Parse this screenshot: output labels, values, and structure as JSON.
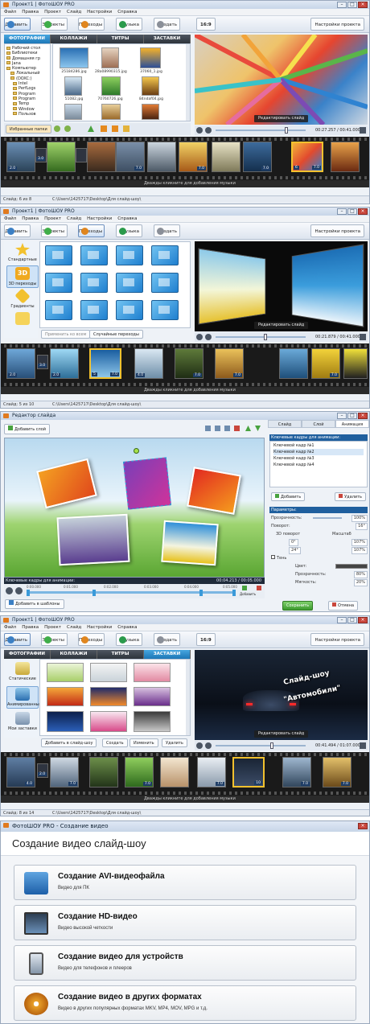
{
  "s1": {
    "title": "Проект1 | ФотоШОУ PRO",
    "menu": [
      "Файл",
      "Правка",
      "Проект",
      "Слайд",
      "Настройки",
      "Справка"
    ],
    "tools": [
      "Добавить",
      "Эффекты",
      "Переходы",
      "Музыка",
      "Создать"
    ],
    "aspect": "16:9",
    "project_settings": "Настройки проекта",
    "tabs": [
      "ФОТОГРАФИИ",
      "КОЛЛАЖИ",
      "ТИТРЫ",
      "ЗАСТАВКИ"
    ],
    "folders": [
      "Рабочий стол",
      "Библиотеки",
      "Домашняя гр",
      "Jana",
      "Компьютер",
      "Локальный",
      "(DOXC:)",
      "Intel",
      "PerfLogs",
      "Program",
      "Program",
      "Temp",
      "Window",
      "Пользов"
    ],
    "files": [
      "25184286.jpg",
      "28a08990315.jpg",
      "37060_1.jpg",
      "",
      "",
      "",
      "51082.jpg",
      "70760726.jpg",
      "84ndaf04.jpg",
      "",
      "",
      ""
    ],
    "fav": "Избранные папки",
    "edit": "Редактировать слайд",
    "time": "00:27.257 / 00:41.000",
    "frames": [
      "2.0",
      "3.0",
      "",
      "",
      "7.0",
      "",
      "7.0",
      "",
      "",
      "7.0",
      "",
      "7.0",
      "6",
      "7.0",
      "3"
    ],
    "music": "Дважды кликните для добавления музыки",
    "status": "Слайд: 6 из 8",
    "path": "C:\\Users\\1425717\\Desktop\\Для слайд-шоу\\"
  },
  "s2": {
    "title": "Проект1 | ФотоШОУ PRO",
    "menu": [
      "Файл",
      "Правка",
      "Проект",
      "Слайд",
      "Настройки",
      "Справка"
    ],
    "tools": [
      "Добавить",
      "Эффекты",
      "Переходы",
      "Музыка",
      "Создать"
    ],
    "project_settings": "Настройки проекта",
    "side": [
      "Стандартные",
      "3D переходы",
      "Градиенты",
      ""
    ],
    "apply_all": "Применить ко всем",
    "random": "Случайные переходы",
    "edit": "Редактировать слайд",
    "time": "00:21.879 / 00:41.000",
    "frames": [
      "2.0",
      "3.0",
      "2.0",
      "7.0",
      "5",
      "7.0",
      "4.0",
      "2.0",
      "7.0",
      "2.0",
      "7.0",
      "2.0",
      "7.0"
    ],
    "music": "Дважды кликните для добавления музыки",
    "status": "Слайд: 5 из 10",
    "path": "C:\\Users\\1425717\\Desktop\\Для слайд-шоу\\"
  },
  "s3": {
    "title": "Редактор слайда",
    "add_layer": "Добавить слой",
    "tabs": [
      "Слайд",
      "Слой",
      "Анимация"
    ],
    "kf_title": "Ключевые кадры для анимации:",
    "keyframes": [
      "Ключевой кадр №1",
      "Ключевой кадр №2",
      "Ключевой кадр №3",
      "Ключевой кадр №4"
    ],
    "add": "Добавить",
    "delete": "Удалить",
    "params": "Параметры:",
    "opacity": "Прозрачность:",
    "opacity_v": "100%",
    "rotate": "Поворот:",
    "rotate_v": "16°",
    "3d": "3D поворот",
    "scale": "Масштаб",
    "v1": "0°",
    "v2": "24°",
    "v3": "107%",
    "v4": "107%",
    "shadow": "Тень",
    "color": "Цвет:",
    "op2": "Прозрачность:",
    "op2_v": "80%",
    "soft": "Мягкость:",
    "soft_v": "20%",
    "kf_bar": "Ключевые кадры для анимации:",
    "kf_time": "00:04.213 / 00:05.000",
    "ticks": [
      "0:00.000",
      "0:01.000",
      "0:02.000",
      "0:03.000",
      "0:04.000",
      "0:05.000"
    ],
    "add_tpl": "Добавить в шаблоны",
    "save": "Сохранить",
    "cancel": "Отмена"
  },
  "s4": {
    "title": "Проект1 | ФотоШОУ PRO",
    "menu": [
      "Файл",
      "Правка",
      "Проект",
      "Слайд",
      "Настройки",
      "Справка"
    ],
    "tools": [
      "Добавить",
      "Эффекты",
      "Переходы",
      "Музыка",
      "Создать"
    ],
    "aspect": "16:9",
    "project_settings": "Настройки проекта",
    "tabs": [
      "ФОТОГРАФИИ",
      "КОЛЛАЖИ",
      "ТИТРЫ",
      "ЗАСТАВКИ"
    ],
    "side": [
      "Статические",
      "Анимированные",
      "Мои заставки"
    ],
    "add_slide": "Добавить в слайд-шоу",
    "create": "Создать",
    "change": "Изменить",
    "delete": "Удалить",
    "preview_line1": "Слайд-шоу",
    "preview_line2": "\"Автомобили\"",
    "edit": "Редактировать слайд",
    "time": "00:41.494 / 01:07.000",
    "frames": [
      "4.0",
      "2.0",
      "7.0",
      "2.0",
      "7.0",
      "2.0",
      "7.0",
      "2.0",
      "7.0",
      "10",
      "7.0",
      "2.0",
      "7.0"
    ],
    "music": "Дважды кликните для добавления музыки",
    "status": "Слайд: 8 из 14",
    "path": "C:\\Users\\1425717\\Desktop\\Для слайд-шоу\\"
  },
  "s5": {
    "title": "ФотоШОУ PRO - Создание видео",
    "heading": "Создание видео слайд-шоу",
    "options": [
      {
        "t": "Создание AVI-видеофайла",
        "s": "Видео для ПК"
      },
      {
        "t": "Создание HD-видео",
        "s": "Видео высокой четкости"
      },
      {
        "t": "Создание видео для устройств",
        "s": "Видео для телефонов и плееров"
      },
      {
        "t": "Создание видео в других форматах",
        "s": "Видео в других популярных форматах MKV, MP4, MOV, MPG и т.д."
      }
    ]
  }
}
